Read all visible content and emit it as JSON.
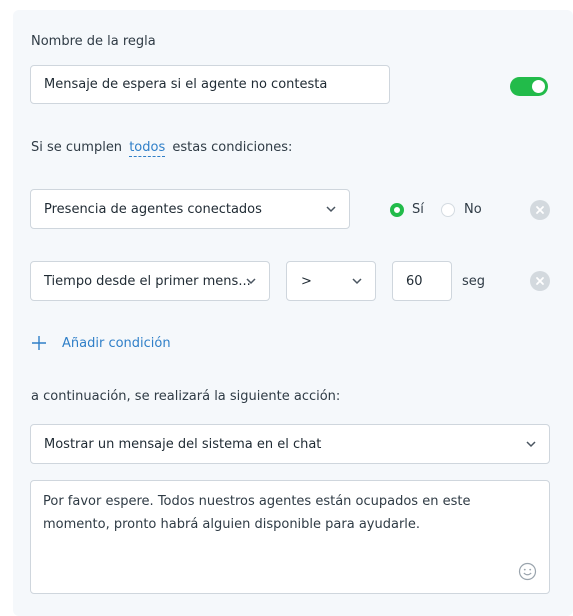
{
  "rule": {
    "name_label": "Nombre de la regla",
    "name_value": "Mensaje de espera si el agente no contesta",
    "enabled": true
  },
  "conditions_intro": {
    "prefix": "Si se cumplen",
    "match_mode": "todos",
    "suffix": "estas condiciones:"
  },
  "conditions": [
    {
      "field": "Presencia de agentes conectados",
      "radio_yes": "Sí",
      "radio_no": "No",
      "selected": "Sí"
    },
    {
      "field": "Tiempo desde el primer mens...",
      "operator": ">",
      "value": "60",
      "unit": "seg"
    }
  ],
  "add_condition_label": "Añadir condición",
  "action": {
    "intro": "a continuación, se realizará la siguiente acción:",
    "selected": "Mostrar un mensaje del sistema en el chat",
    "message": "Por favor espere. Todos nuestros agentes están ocupados en este momento, pronto habrá alguien disponible para ayudarle."
  },
  "colors": {
    "accent_green": "#22bb4a",
    "link_blue": "#2f7fc8",
    "panel_bg": "#f5f8fb"
  },
  "icons": [
    "chevron-down-icon",
    "remove-icon",
    "plus-icon",
    "emoji-icon"
  ]
}
